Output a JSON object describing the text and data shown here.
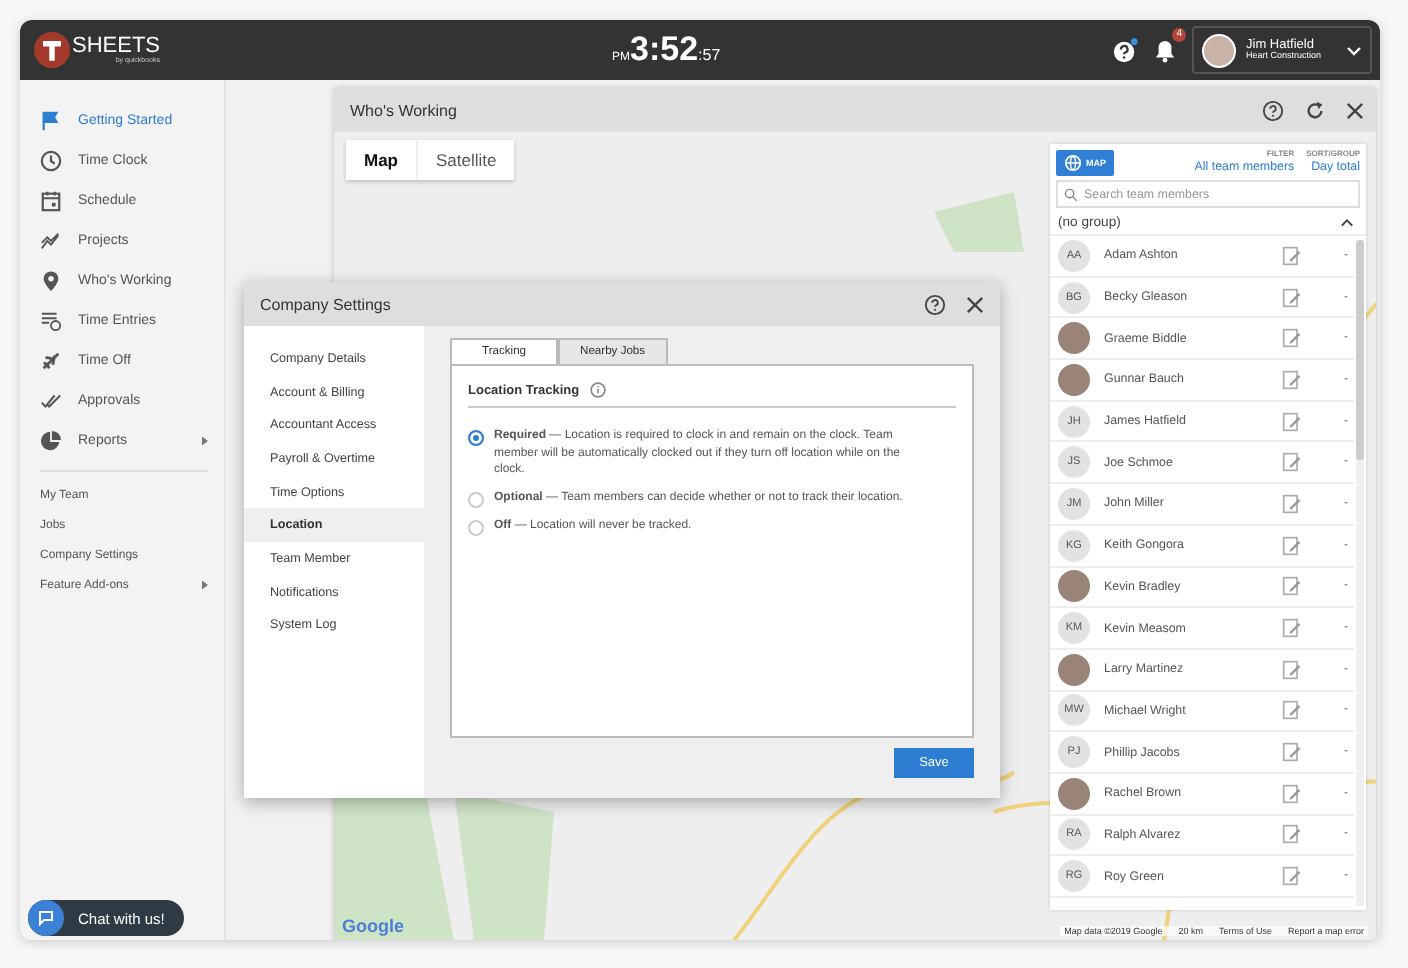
{
  "top_bar": {
    "logo_text": "SHEETS",
    "logo_sub": "by quickbooks",
    "clock": {
      "period": "PM",
      "time": "3:52",
      "seconds": ":57"
    },
    "notification_count": "4",
    "user": {
      "name": "Jim Hatfield",
      "company": "Heart Construction"
    }
  },
  "sidebar": {
    "items": [
      {
        "label": "Getting Started",
        "selected": true,
        "submenu": false
      },
      {
        "label": "Time Clock",
        "selected": false,
        "submenu": false
      },
      {
        "label": "Schedule",
        "selected": false,
        "submenu": false
      },
      {
        "label": "Projects",
        "selected": false,
        "submenu": false
      },
      {
        "label": "Who's Working",
        "selected": false,
        "submenu": false
      },
      {
        "label": "Time Entries",
        "selected": false,
        "submenu": false
      },
      {
        "label": "Time Off",
        "selected": false,
        "submenu": false
      },
      {
        "label": "Approvals",
        "selected": false,
        "submenu": false
      },
      {
        "label": "Reports",
        "selected": false,
        "submenu": true
      }
    ],
    "links": [
      {
        "label": "My Team",
        "submenu": false
      },
      {
        "label": "Jobs",
        "submenu": false
      },
      {
        "label": "Company Settings",
        "submenu": false
      },
      {
        "label": "Feature Add-ons",
        "submenu": true
      }
    ]
  },
  "window": {
    "title": "Who's Working",
    "map_types": [
      {
        "label": "Map",
        "selected": true
      },
      {
        "label": "Satellite",
        "selected": false
      }
    ],
    "map_logo": "Google",
    "map_attribution": [
      "Map data ©2019 Google",
      "20 km",
      "Terms of Use",
      "Report a map error"
    ]
  },
  "team_panel": {
    "view_button": "MAP",
    "filter": {
      "label": "FILTER",
      "value": "All team members"
    },
    "sort": {
      "label": "SORT/GROUP",
      "value": "Day total"
    },
    "search": {
      "placeholder": "Search team members"
    },
    "group": {
      "name": "(no group)",
      "expanded": true
    },
    "members": [
      {
        "kind": "initials",
        "initials": "AA",
        "name": "Adam Ashton",
        "hours": "-"
      },
      {
        "kind": "initials",
        "initials": "BG",
        "name": "Becky Gleason",
        "hours": "-"
      },
      {
        "kind": "photo",
        "name": "Graeme Biddle",
        "hours": "-"
      },
      {
        "kind": "photo",
        "name": "Gunnar Bauch",
        "hours": "-"
      },
      {
        "kind": "initials",
        "initials": "JH",
        "name": "James Hatfield",
        "hours": "-"
      },
      {
        "kind": "initials",
        "initials": "JS",
        "name": "Joe Schmoe",
        "hours": "-"
      },
      {
        "kind": "initials",
        "initials": "JM",
        "name": "John Miller",
        "hours": "-"
      },
      {
        "kind": "initials",
        "initials": "KG",
        "name": "Keith Gongora",
        "hours": "-"
      },
      {
        "kind": "photo",
        "name": "Kevin Bradley",
        "hours": "-"
      },
      {
        "kind": "initials",
        "initials": "KM",
        "name": "Kevin Measom",
        "hours": "-"
      },
      {
        "kind": "photo",
        "name": "Larry Martinez",
        "hours": "-"
      },
      {
        "kind": "initials",
        "initials": "MW",
        "name": "Michael Wright",
        "hours": "-"
      },
      {
        "kind": "initials",
        "initials": "PJ",
        "name": "Phillip Jacobs",
        "hours": "-"
      },
      {
        "kind": "photo",
        "name": "Rachel Brown",
        "hours": "-"
      },
      {
        "kind": "initials",
        "initials": "RA",
        "name": "Ralph Alvarez",
        "hours": "-"
      },
      {
        "kind": "initials",
        "initials": "RG",
        "name": "Roy Green",
        "hours": "-"
      }
    ]
  },
  "dialog": {
    "title": "Company Settings",
    "nav": [
      {
        "label": "Company Details",
        "selected": false
      },
      {
        "label": "Account & Billing",
        "selected": false
      },
      {
        "label": "Accountant Access",
        "selected": false
      },
      {
        "label": "Payroll & Overtime",
        "selected": false
      },
      {
        "label": "Time Options",
        "selected": false
      },
      {
        "label": "Location",
        "selected": true
      },
      {
        "label": "Team Member",
        "selected": false
      },
      {
        "label": "Notifications",
        "selected": false
      },
      {
        "label": "System Log",
        "selected": false
      }
    ],
    "tabs": [
      {
        "label": "Tracking",
        "selected": true
      },
      {
        "label": "Nearby Jobs",
        "selected": false
      }
    ],
    "section_title": "Location Tracking",
    "options": [
      {
        "text": "**Required** — Location is required to clock in and remain on the clock. Team member will be automatically clocked out if they turn off location while on the clock.",
        "selected": true
      },
      {
        "text": "**Optional** — Team members can decide whether or not to track their location.",
        "selected": false
      },
      {
        "text": "**Off** — Location will never be tracked.",
        "selected": false
      }
    ],
    "save": "Save"
  },
  "chat": {
    "label": "Chat with us!"
  }
}
